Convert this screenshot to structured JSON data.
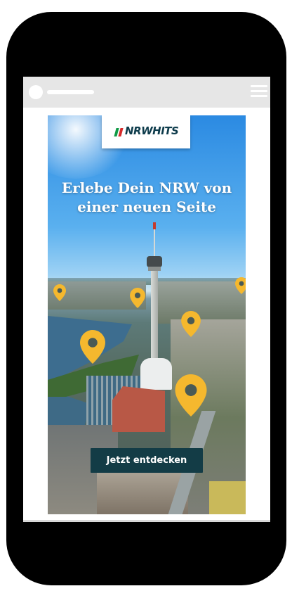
{
  "ad": {
    "logo_text": "NRWHITS",
    "headline_line1": "Erlebe Dein NRW von",
    "headline_line2": "einer neuen Seite",
    "cta_label": "Jetzt entdecken"
  },
  "colors": {
    "brand_dark": "#133c46",
    "pin_yellow": "#f5b82e",
    "logo_green": "#119a46",
    "logo_red": "#d62b2b",
    "sky_blue": "#2b8ae2"
  },
  "icons": {
    "menu": "hamburger-menu-icon",
    "pin": "map-pin-icon",
    "logo": "nrwhits-logo"
  }
}
